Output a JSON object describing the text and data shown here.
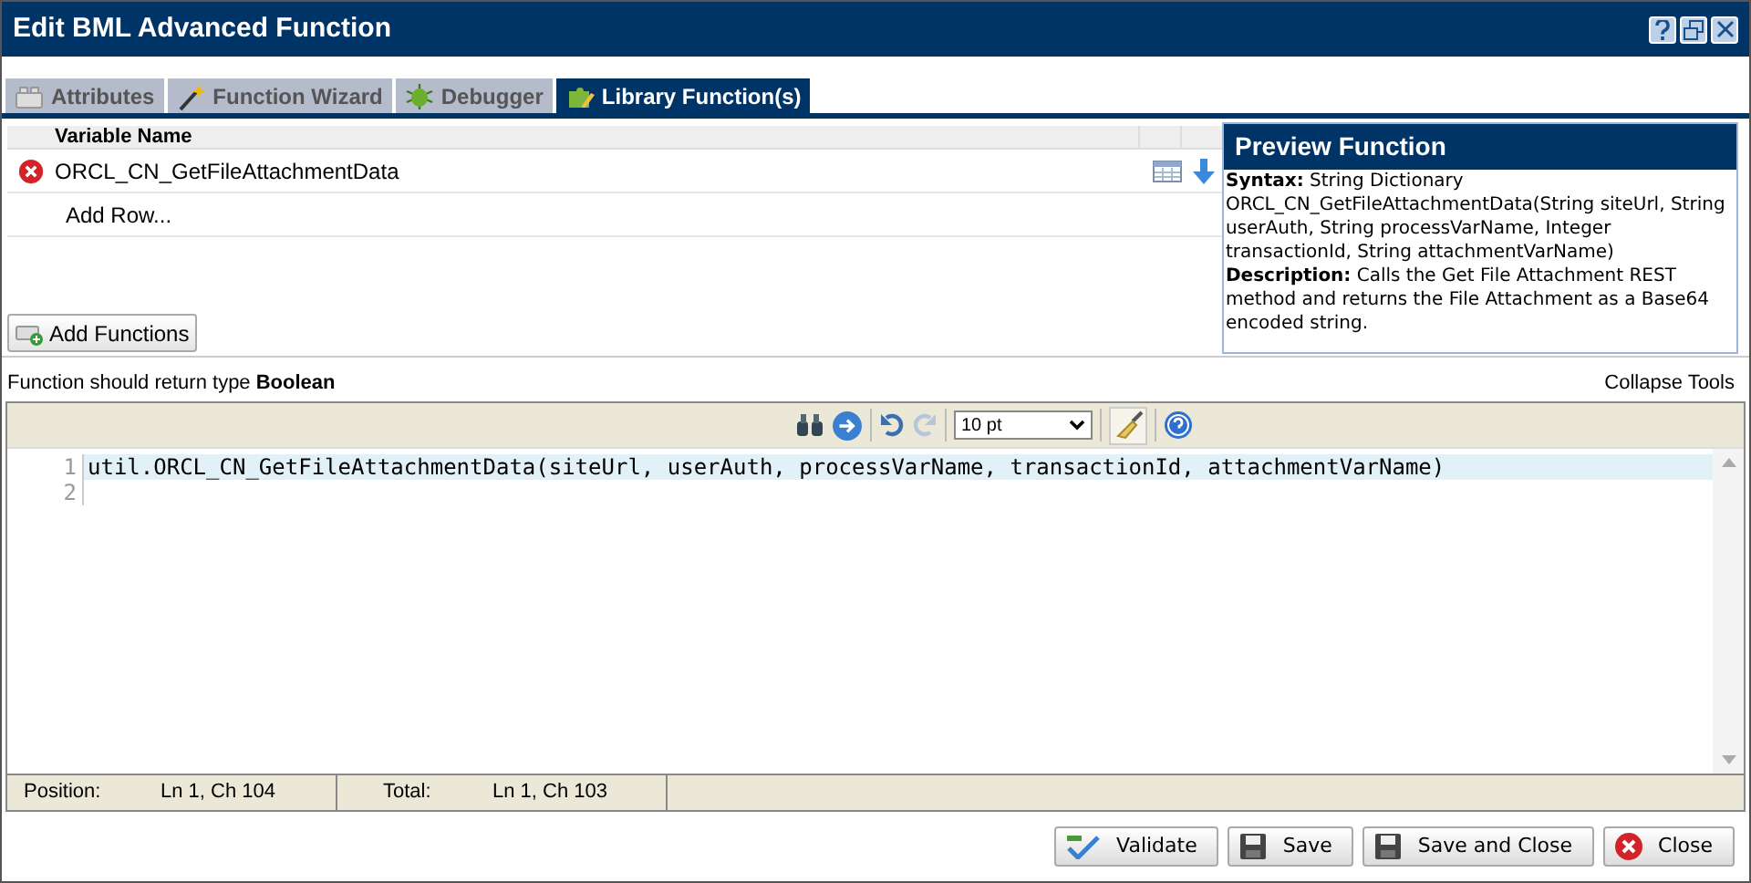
{
  "window": {
    "title": "Edit BML Advanced Function"
  },
  "tabs": [
    {
      "label": "Attributes",
      "kind": "bricks",
      "selected": false
    },
    {
      "label": "Function Wizard",
      "kind": "wand",
      "selected": false
    },
    {
      "label": "Debugger",
      "kind": "bug",
      "selected": false
    },
    {
      "label": "Library Function(s)",
      "kind": "puzzle",
      "selected": true
    }
  ],
  "table": {
    "columns": [
      "Variable Name"
    ],
    "rows": [
      {
        "name": "ORCL_CN_GetFileAttachmentData",
        "error": true
      }
    ],
    "add_row": "Add Row..."
  },
  "add_functions_button": "Add Functions",
  "preview": {
    "title": "Preview Function",
    "syntax": "**Syntax:** String Dictionary ORCL_CN_GetFileAttachmentData(String siteUrl, String userAuth, String processVarName, Integer transactionId, String attachmentVarName)",
    "description": "**Description:** Calls the Get File Attachment REST method and returns the File Attachment as a Base64 encoded string."
  },
  "return_type": "Function should return type **Boolean**",
  "collapse_tools": "Collapse Tools",
  "toolbar": {
    "font_size": "10 pt"
  },
  "editor": {
    "lines": [
      {
        "number": "1",
        "text": "util.ORCL_CN_GetFileAttachmentData(siteUrl, userAuth, processVarName, transactionId, attachmentVarName)",
        "current": true
      },
      {
        "number": "2",
        "current": false
      }
    ]
  },
  "status_bar": {
    "position_label": "Position:",
    "position": "Ln 1, Ch 104",
    "total_label": "Total:",
    "total": "Ln 1, Ch 103"
  },
  "buttons": [
    {
      "label": "Validate",
      "kind": "validate"
    },
    {
      "label": "Save",
      "kind": "save"
    },
    {
      "label": "Save and Close",
      "kind": "save"
    },
    {
      "label": "Close",
      "kind": "close"
    }
  ]
}
